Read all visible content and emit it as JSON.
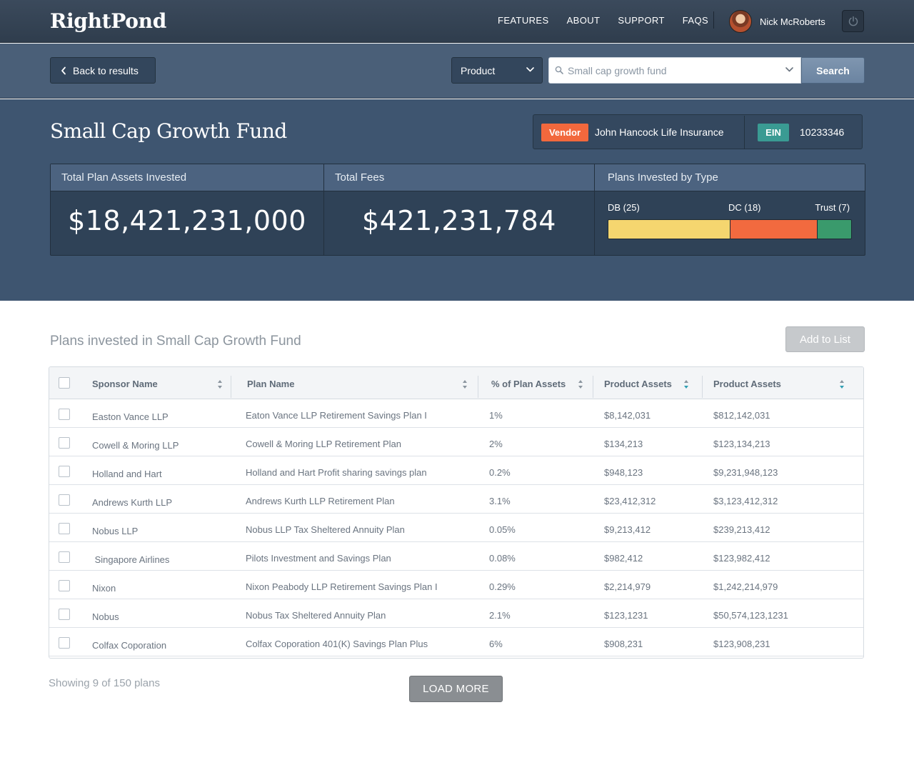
{
  "brand": {
    "name": "RightPond"
  },
  "nav": {
    "links": [
      "FEATURES",
      "ABOUT",
      "SUPPORT",
      "FAQS"
    ],
    "user_name": "Nick McRoberts"
  },
  "searchbar": {
    "back_label": "Back to results",
    "scope_select": "Product",
    "search_value": "Small cap growth fund",
    "search_button": "Search"
  },
  "fund": {
    "title": "Small Cap Growth Fund",
    "vendor_label": "Vendor",
    "vendor_name": "John Hancock Life Insurance",
    "ein_label": "EIN",
    "ein_value": "10233346"
  },
  "stats": {
    "assets_label": "Total Plan Assets Invested",
    "assets_value": "$18,421,231,000",
    "fees_label": "Total Fees",
    "fees_value": "$421,231,784",
    "types_label": "Plans Invested by Type",
    "types": [
      {
        "label": "DB (25)",
        "count": 25,
        "color": "#f5d66f"
      },
      {
        "label": "DC (18)",
        "count": 18,
        "color": "#f26a3f"
      },
      {
        "label": "Trust (7)",
        "count": 7,
        "color": "#3a9a6c"
      }
    ]
  },
  "plans": {
    "section_title": "Plans invested in Small Cap Growth Fund",
    "add_to_list": "Add to List",
    "columns": [
      "Sponsor Name",
      "Plan Name",
      "% of Plan Assets",
      "Product Assets",
      "Product Assets"
    ],
    "rows": [
      [
        "Easton Vance LLP",
        "Eaton Vance LLP Retirement Savings Plan I",
        "1%",
        "$8,142,031",
        "$812,142,031"
      ],
      [
        "Cowell & Moring LLP",
        "Cowell & Moring LLP Retirement Plan",
        "2%",
        "$134,213",
        "$123,134,213"
      ],
      [
        "Holland and Hart",
        "Holland and Hart Profit sharing savings plan",
        "0.2%",
        "$948,123",
        "$9,231,948,123"
      ],
      [
        "Andrews Kurth LLP",
        "Andrews Kurth LLP Retirement Plan",
        "3.1%",
        "$23,412,312",
        "$3,123,412,312"
      ],
      [
        "Nobus LLP",
        "Nobus LLP Tax Sheltered Annuity Plan",
        "0.05%",
        "$9,213,412",
        "$239,213,412"
      ],
      [
        " Singapore Airlines",
        "Pilots Investment and Savings Plan",
        "0.08%",
        "$982,412",
        "$123,982,412"
      ],
      [
        "Nixon",
        "Nixon Peabody LLP Retirement Savings Plan I",
        "0.29%",
        "$2,214,979",
        "$1,242,214,979"
      ],
      [
        "Nobus",
        "Nobus Tax Sheltered Annuity Plan",
        "2.1%",
        "$123,1231",
        "$50,574,123,1231"
      ],
      [
        "Colfax Coporation",
        "Colfax Coporation 401(K) Savings Plan Plus",
        "6%",
        "$908,231",
        "$123,908,231"
      ]
    ],
    "showing_text": "Showing 9 of 150 plans",
    "load_more": "LOAD MORE"
  },
  "icons": {
    "back": "chevron-left-icon",
    "dropdown": "chevron-down-icon",
    "search": "magnifier-icon",
    "power": "power-icon",
    "sort": "sort-arrows-icon"
  }
}
